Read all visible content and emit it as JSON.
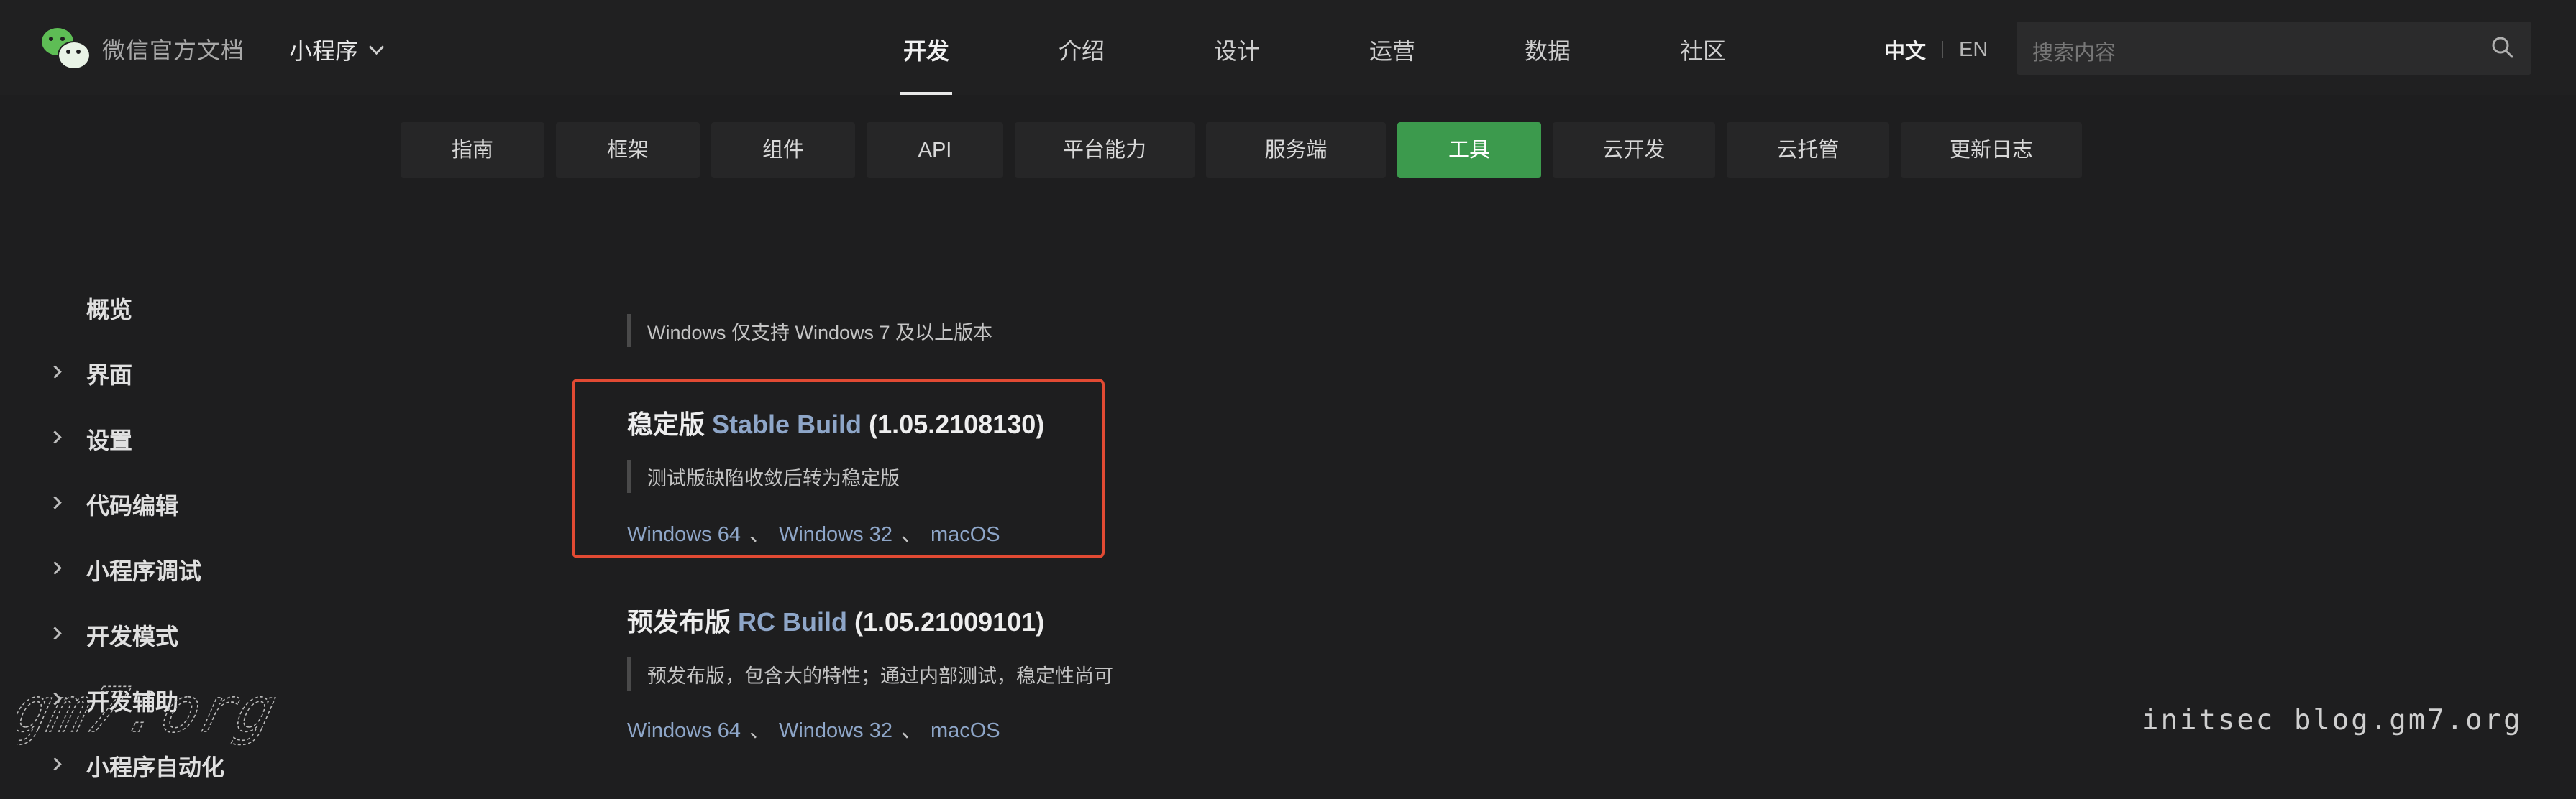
{
  "header": {
    "brand": "微信官方文档",
    "product": "小程序",
    "nav": [
      "开发",
      "介绍",
      "设计",
      "运营",
      "数据",
      "社区"
    ],
    "active_nav": "开发",
    "lang_zh": "中文",
    "lang_en": "EN",
    "search_placeholder": "搜索内容"
  },
  "subnav": {
    "tabs": [
      "指南",
      "框架",
      "组件",
      "API",
      "平台能力",
      "服务端",
      "工具",
      "云开发",
      "云托管",
      "更新日志"
    ],
    "active": "工具"
  },
  "sidebar": {
    "items": [
      {
        "label": "概览",
        "expandable": false
      },
      {
        "label": "界面",
        "expandable": true
      },
      {
        "label": "设置",
        "expandable": true
      },
      {
        "label": "代码编辑",
        "expandable": true
      },
      {
        "label": "小程序调试",
        "expandable": true
      },
      {
        "label": "开发模式",
        "expandable": true
      },
      {
        "label": "开发辅助",
        "expandable": true
      },
      {
        "label": "小程序自动化",
        "expandable": true
      }
    ]
  },
  "content": {
    "windows_note": "Windows 仅支持 Windows 7 及以上版本",
    "stable": {
      "title_cn": "稳定版",
      "title_en": "Stable Build",
      "version": "(1.05.2108130)",
      "note": "测试版缺陷收敛后转为稳定版",
      "links": [
        "Windows 64",
        "Windows 32",
        "macOS"
      ],
      "separator": "、"
    },
    "rc": {
      "title_cn": "预发布版",
      "title_en": "RC Build",
      "version": "(1.05.21009101)",
      "note": "预发布版，包含大的特性；通过内部测试，稳定性尚可",
      "links": [
        "Windows 64",
        "Windows 32",
        "macOS"
      ],
      "separator": "、"
    }
  },
  "watermark": {
    "right": "initsec blog.gm7.org",
    "left": "gm7.org"
  },
  "colors": {
    "background": "#1e1e1f",
    "active_tab": "#3c9a4d",
    "link": "#8ea6c8",
    "highlight_border": "#e24a33"
  },
  "icons": [
    "wechat-logo-icon",
    "chevron-down-icon",
    "search-icon",
    "chevron-right-icon"
  ]
}
